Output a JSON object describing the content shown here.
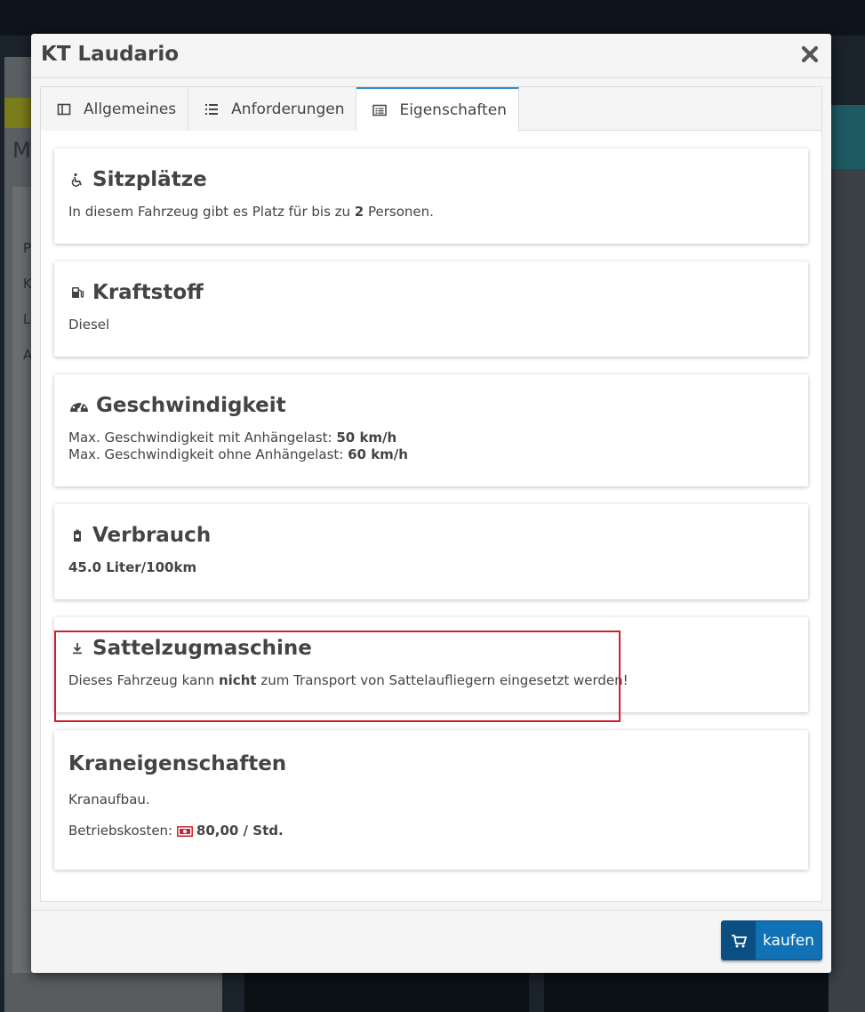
{
  "modal": {
    "title": "KT Laudario"
  },
  "tabs": [
    {
      "label": "Allgemeines",
      "icon": "columns-icon"
    },
    {
      "label": "Anforderungen",
      "icon": "list-icon"
    },
    {
      "label": "Eigenschaften",
      "icon": "list-alt-icon",
      "active": true
    }
  ],
  "cards": {
    "seats": {
      "title": "Sitzplätze",
      "text_before": "In diesem Fahrzeug gibt es Platz für bis zu ",
      "count": "2",
      "text_after": " Personen."
    },
    "fuel": {
      "title": "Kraftstoff",
      "value": "Diesel"
    },
    "speed": {
      "title": "Geschwindigkeit",
      "with_trailer_label": "Max. Geschwindigkeit mit Anhängelast: ",
      "with_trailer_value": "50 km/h",
      "without_trailer_label": "Max. Geschwindigkeit ohne Anhängelast: ",
      "without_trailer_value": "60 km/h"
    },
    "consumption": {
      "title": "Verbrauch",
      "value": "45.0 Liter/100km"
    },
    "semitrailer": {
      "title": "Sattelzugmaschine",
      "text_before": "Dieses Fahrzeug kann ",
      "emphasis": "nicht",
      "text_after": " zum Transport von Sattelaufliegern eingesetzt werden!"
    },
    "crane": {
      "title": "Kraneigenschaften",
      "description": "Kranaufbau.",
      "cost_label": "Betriebskosten: ",
      "cost_value": "80,00 / Std."
    }
  },
  "footer": {
    "buy_label": "kaufen"
  },
  "background": {
    "letters": [
      "M",
      "P",
      "K",
      "L",
      "A"
    ]
  },
  "colors": {
    "accent": "#1071b5",
    "highlight": "#d21f2a",
    "money": "#c9232d"
  }
}
